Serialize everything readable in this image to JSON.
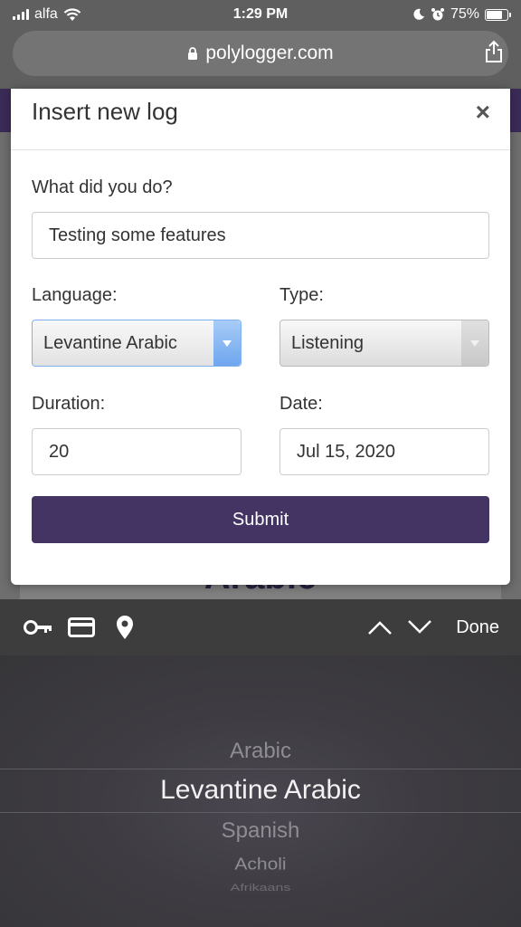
{
  "status_bar": {
    "carrier": "alfa",
    "time": "1:29 PM",
    "battery": "75%",
    "battery_level": 0.75
  },
  "browser": {
    "url": "polylogger.com"
  },
  "background_page": {
    "heading_fragment": "Arabic"
  },
  "modal": {
    "title": "Insert new log",
    "close_label": "×",
    "activity_label": "What did you do?",
    "activity_value": "Testing some features",
    "language_label": "Language:",
    "language_value": "Levantine Arabic",
    "type_label": "Type:",
    "type_value": "Listening",
    "duration_label": "Duration:",
    "duration_value": "20",
    "date_label": "Date:",
    "date_value": "Jul 15, 2020",
    "submit_label": "Submit"
  },
  "toolbar": {
    "icons": [
      "key-icon",
      "credit-card-icon",
      "location-pin-icon"
    ],
    "done_label": "Done"
  },
  "picker": {
    "items": [
      "Arabic",
      "Levantine Arabic",
      "Spanish",
      "Acholi",
      "Afrikaans"
    ],
    "selected": "Levantine Arabic"
  },
  "colors": {
    "brand_purple": "#433463",
    "header_strip": "#3b2b57",
    "focus_blue": "#7fb0f0"
  }
}
